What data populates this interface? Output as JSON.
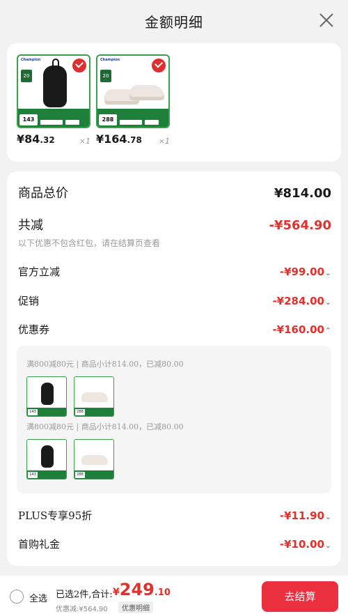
{
  "header": {
    "title": "金额明细"
  },
  "products": [
    {
      "name": "bag",
      "price_int": "¥84",
      "price_dec": ".32",
      "qty": "×1",
      "tag_price": "143"
    },
    {
      "name": "shoes",
      "price_int": "¥164",
      "price_dec": ".78",
      "qty": "×1",
      "tag_price": "288"
    }
  ],
  "summary": {
    "goods_total_label": "商品总价",
    "goods_total_value": "¥814.00",
    "total_reduce_label": "共减",
    "total_reduce_value": "-¥564.90",
    "note": "以下优惠不包含红包，请在结算页查看"
  },
  "discounts": [
    {
      "label": "官方立减",
      "value": "-¥99.00",
      "chevron": "⌄"
    },
    {
      "label": "促销",
      "value": "-¥284.00",
      "chevron": "⌄"
    },
    {
      "label": "优惠券",
      "value": "-¥160.00",
      "chevron": "⌃"
    },
    {
      "label": "PLUS专享95折",
      "value": "-¥11.90",
      "chevron": "⌄"
    },
    {
      "label": "首购礼金",
      "value": "-¥10.00",
      "chevron": "⌄"
    }
  ],
  "coupons": [
    {
      "text": "满800减80元 | 商品小计814.00，已减80.00"
    },
    {
      "text": "满800减80元 | 商品小计814.00，已减80.00"
    }
  ],
  "bottom": {
    "select_all": "全选",
    "selected": "已选2件,合计:",
    "total_cur": "¥",
    "total_int": "249",
    "total_dec": ".10",
    "discount": "优惠减:¥564.90",
    "detail_link": "优惠明细",
    "checkout": "去结算"
  },
  "colors": {
    "accent": "#e1312d",
    "checkout": "#ea2f3f",
    "tag_green": "#1d7f3a"
  }
}
